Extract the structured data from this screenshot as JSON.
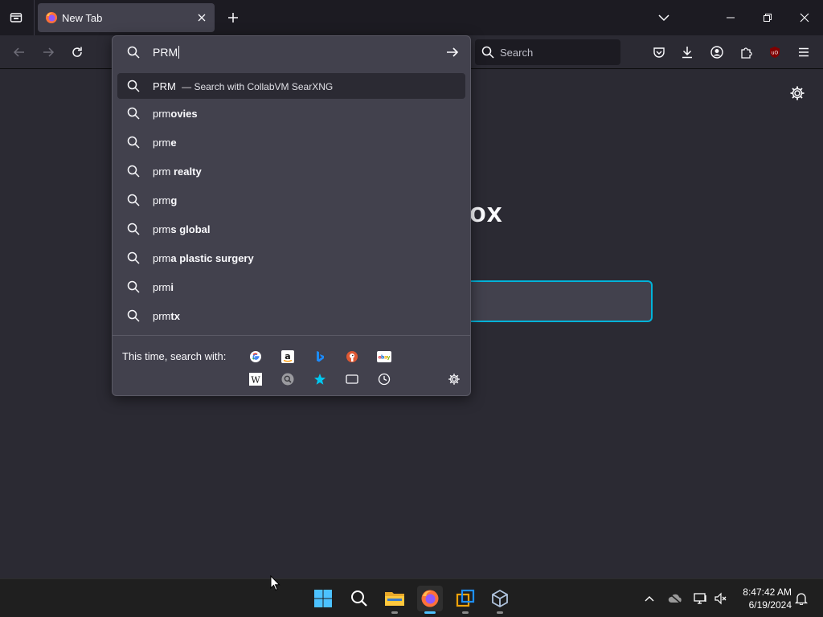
{
  "tab": {
    "title": "New Tab"
  },
  "searchbar": {
    "placeholder": "Search"
  },
  "urlbar": {
    "value": "PRM"
  },
  "results": [
    {
      "typed": "PRM",
      "rest": "",
      "sub": "— Search with CollabVM SearXNG",
      "selected": true
    },
    {
      "typed": "prm",
      "rest": "ovies"
    },
    {
      "typed": "prm",
      "rest": "e"
    },
    {
      "typed": "prm",
      "rest": " realty"
    },
    {
      "typed": "prm",
      "rest": "g"
    },
    {
      "typed": "prm",
      "rest": "s global"
    },
    {
      "typed": "prm",
      "rest": "a plastic surgery"
    },
    {
      "typed": "prm",
      "rest": "i"
    },
    {
      "typed": "prm",
      "rest": "tx"
    }
  ],
  "oneoff": {
    "label": "This time, search with:",
    "engines": [
      "google-icon",
      "amazon-icon",
      "bing-icon",
      "duckduckgo-icon",
      "ebay-icon",
      "wikipedia-icon",
      "searxng-icon",
      "bookmarks-icon",
      "tabs-icon",
      "history-icon"
    ]
  },
  "brand": {
    "text": "ox"
  },
  "clock": {
    "time": "8:47:42 AM",
    "date": "6/19/2024"
  },
  "colors": {
    "accent": "#00b3d9",
    "panel": "#42414d",
    "toolbar": "#2b2a33",
    "taskbar_active": "#4cc2ff"
  }
}
